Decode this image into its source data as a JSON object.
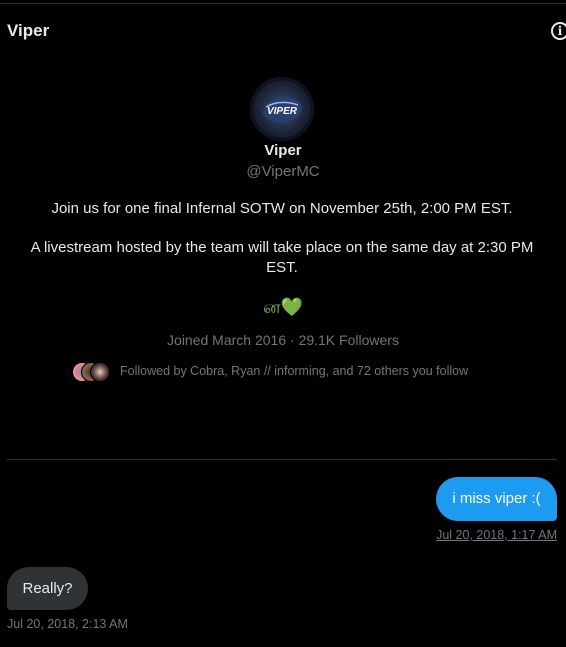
{
  "header": {
    "title": "Viper",
    "info_icon": "info-icon"
  },
  "profile": {
    "name": "Viper",
    "handle": "@ViperMC",
    "avatar_text": "VIPER",
    "bio_line1": "Join us for one final Infernal SOTW on November 25th, 2:00 PM EST.",
    "bio_line2": "A livestream hosted by the team will take place on the same day at 2:30 PM EST.",
    "emojis": "ன💚",
    "joined": "Joined March 2016",
    "separator": "·",
    "followers": "29.1K Followers",
    "followed_by": "Followed by Cobra, Ryan // informing, and 72 others you follow"
  },
  "messages": [
    {
      "direction": "outgoing",
      "text": "i miss viper :(",
      "timestamp": "Jul 20, 2018, 1:17 AM"
    },
    {
      "direction": "incoming",
      "text": "Really?",
      "timestamp": "Jul 20, 2018, 2:13 AM"
    }
  ],
  "colors": {
    "background": "#000000",
    "accent": "#1d9bf0",
    "muted_text": "#71767b",
    "incoming_bubble": "#2f3336",
    "emoji_green": "#78b159"
  }
}
